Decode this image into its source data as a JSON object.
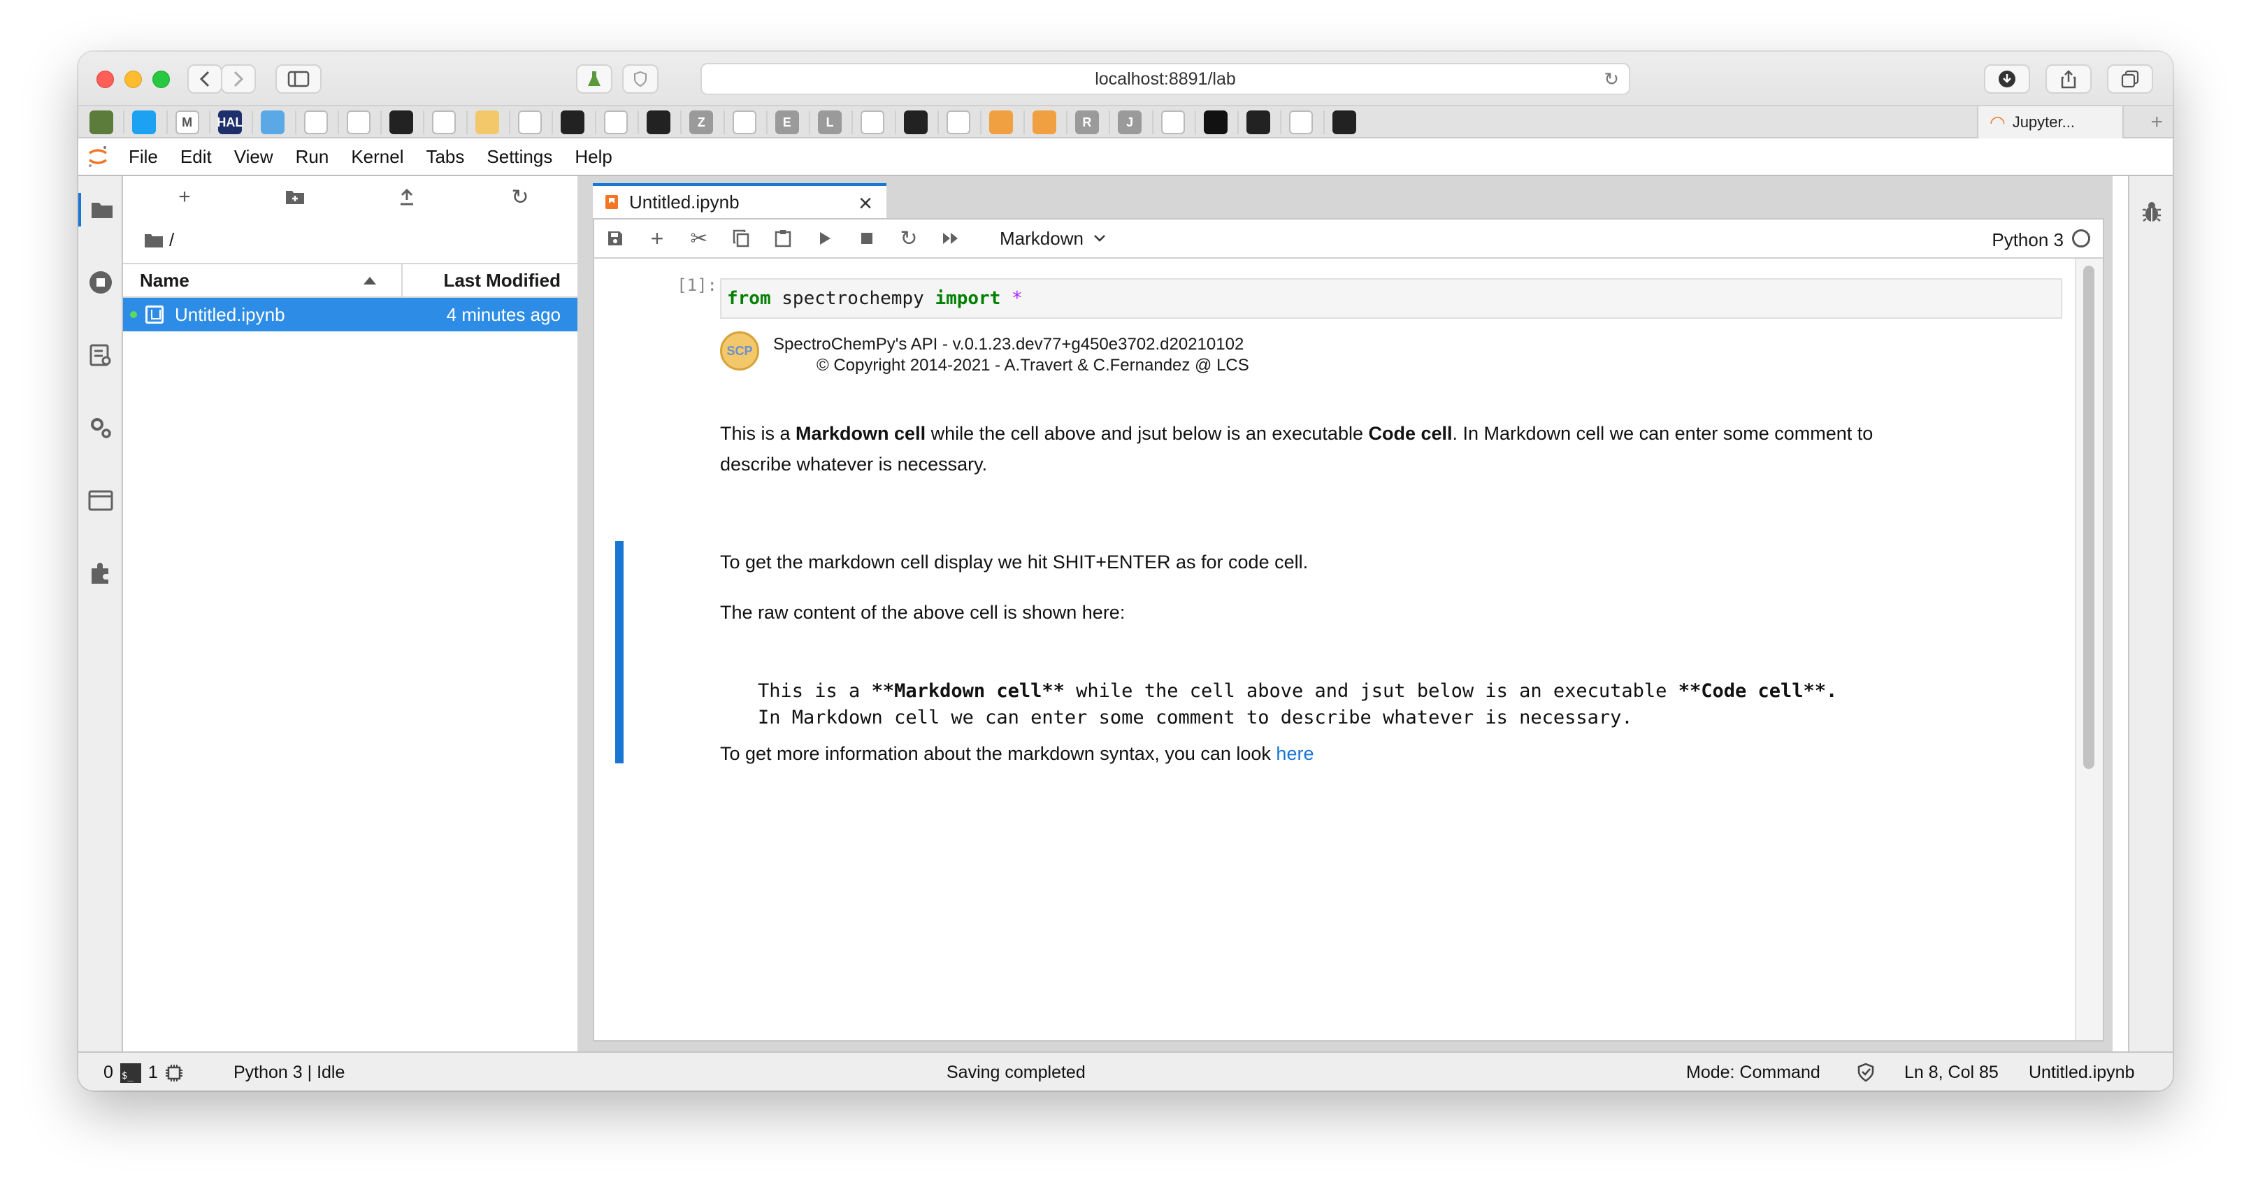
{
  "browser": {
    "url": "localhost:8891/lab",
    "active_tab_label": "Jupyter...",
    "favorites": [
      {
        "icon": "notebook-icon",
        "color": "#5b7c3a",
        "label": ""
      },
      {
        "icon": "twitter-icon",
        "color": "#1da1f2",
        "label": ""
      },
      {
        "icon": "gmail-icon",
        "color": "#ffffff",
        "label": "M"
      },
      {
        "icon": "hal-icon",
        "color": "#1f2f6b",
        "label": "HAL"
      },
      {
        "icon": "circle-icon",
        "color": "#5aa9e6",
        "label": ""
      },
      {
        "icon": "wave-icon",
        "color": "#ffffff",
        "label": ""
      },
      {
        "icon": "globe-icon",
        "color": "#ffffff",
        "label": ""
      },
      {
        "icon": "chart-icon",
        "color": "#222222",
        "label": ""
      },
      {
        "icon": "mask-icon",
        "color": "#ffffff",
        "label": ""
      },
      {
        "icon": "scp-icon",
        "color": "#f2c86a",
        "label": ""
      },
      {
        "icon": "ring-icon",
        "color": "#ffffff",
        "label": ""
      },
      {
        "icon": "github-icon",
        "color": "#222222",
        "label": ""
      },
      {
        "icon": "globe-icon",
        "color": "#ffffff",
        "label": ""
      },
      {
        "icon": "github-icon",
        "color": "#222222",
        "label": ""
      },
      {
        "icon": "z-icon",
        "color": "#9a9a9a",
        "label": "Z"
      },
      {
        "icon": "cat-icon",
        "color": "#ffffff",
        "label": ""
      },
      {
        "icon": "e-icon",
        "color": "#9a9a9a",
        "label": "E"
      },
      {
        "icon": "l-icon",
        "color": "#9a9a9a",
        "label": "L"
      },
      {
        "icon": "compass-icon",
        "color": "#ffffff",
        "label": ""
      },
      {
        "icon": "github-icon",
        "color": "#222222",
        "label": ""
      },
      {
        "icon": "jupyter-icon",
        "color": "#ffffff",
        "label": ""
      },
      {
        "icon": "book-icon",
        "color": "#f0a040",
        "label": ""
      },
      {
        "icon": "book-icon",
        "color": "#f0a040",
        "label": ""
      },
      {
        "icon": "r-icon",
        "color": "#9a9a9a",
        "label": "R"
      },
      {
        "icon": "j-icon",
        "color": "#9a9a9a",
        "label": "J"
      },
      {
        "icon": "jupyter-icon",
        "color": "#ffffff",
        "label": ""
      },
      {
        "icon": "medium-icon",
        "color": "#111111",
        "label": ""
      },
      {
        "icon": "c-icon",
        "color": "#222222",
        "label": ""
      },
      {
        "icon": "keyboard-icon",
        "color": "#ffffff",
        "label": ""
      },
      {
        "icon": "github-icon",
        "color": "#222222",
        "label": ""
      }
    ]
  },
  "menu": [
    "File",
    "Edit",
    "View",
    "Run",
    "Kernel",
    "Tabs",
    "Settings",
    "Help"
  ],
  "filebrowser": {
    "path": "/",
    "col_name": "Name",
    "col_modified": "Last Modified",
    "files": [
      {
        "name": "Untitled.ipynb",
        "modified": "4 minutes ago"
      }
    ]
  },
  "notebook": {
    "tab_title": "Untitled.ipynb",
    "cell_type": "Markdown",
    "kernel": "Python 3",
    "prompt": "[1]:",
    "code": {
      "kw1": "from",
      "module": " spectrochempy ",
      "kw2": "import",
      "star": " *"
    },
    "output_line1": "SpectroChemPy's API - v.0.1.23.dev77+g450e3702.d20210102",
    "output_line2": "© Copyright 2014-2021 - A.Travert & C.Fernandez @ LCS",
    "scp_logo_label": "SCP",
    "md1": {
      "a": "This is a ",
      "b": "Markdown cell",
      "c": " while the cell above and jsut below is an executable ",
      "d": "Code cell",
      "e": ". In Markdown cell we can enter some comment to",
      "f": "describe whatever is necessary."
    },
    "md2": "To get the markdown cell display we hit SHIT+ENTER as for code cell.",
    "md3": "The raw content of the above cell is shown here:",
    "raw": {
      "l1a": "This is a ",
      "l1b": "**Markdown cell**",
      "l1c": " while the cell above and jsut below is an executable ",
      "l1d": "**Code cell**.",
      "l2": "In Markdown cell we can enter some comment to describe whatever is necessary."
    },
    "md4": "To get more information about the markdown syntax, you can look ",
    "md4_link": "here"
  },
  "status": {
    "count0": "0",
    "count1": "1",
    "kernel_status": "Python 3 | Idle",
    "message": "Saving completed",
    "mode": "Mode: Command",
    "position": "Ln 8, Col 85",
    "filename": "Untitled.ipynb"
  },
  "colors": {
    "accent": "#1976d2",
    "selection": "#2d8ce6"
  }
}
